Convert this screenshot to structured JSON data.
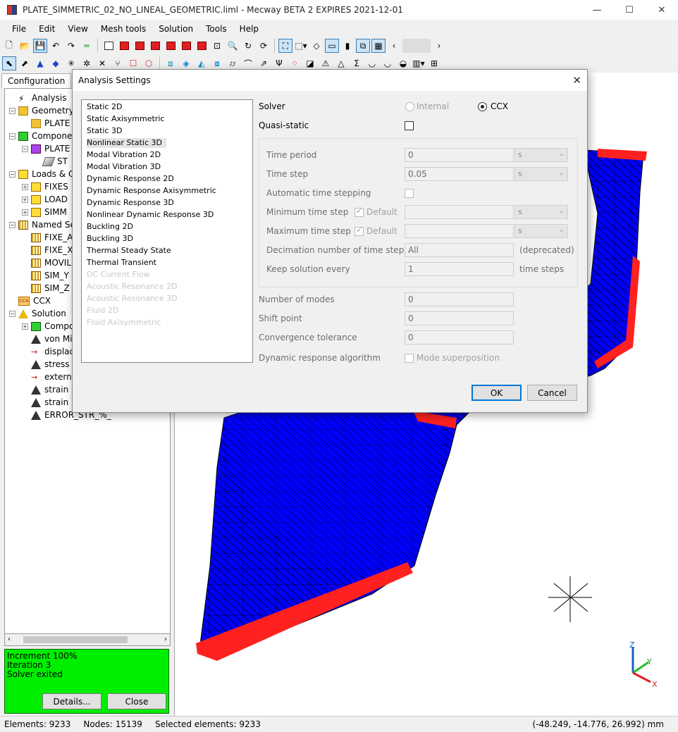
{
  "window": {
    "title": "PLATE_SIMMETRIC_02_NO_LINEAL_GEOMETRIC.liml - Mecway BETA 2 EXPIRES 2021-12-01",
    "minimize": "—",
    "maximize": "☐",
    "close": "✕"
  },
  "menu": [
    "File",
    "Edit",
    "View",
    "Mesh tools",
    "Solution",
    "Tools",
    "Help"
  ],
  "left_tab": "Configuration",
  "tree": [
    {
      "label": "Analysis",
      "indent": 0,
      "icon": "bolt",
      "toggle": ""
    },
    {
      "label": "Geometry",
      "indent": 0,
      "icon": "folder",
      "toggle": "−"
    },
    {
      "label": "PLATE",
      "indent": 1,
      "icon": "folder",
      "toggle": ""
    },
    {
      "label": "Components",
      "indent": 0,
      "icon": "green",
      "toggle": "−"
    },
    {
      "label": "PLATE",
      "indent": 1,
      "icon": "purple",
      "toggle": "−"
    },
    {
      "label": "ST",
      "indent": 2,
      "icon": "sheet",
      "toggle": ""
    },
    {
      "label": "Loads & Constraints",
      "indent": 0,
      "icon": "yellow",
      "toggle": "−"
    },
    {
      "label": "FIXES",
      "indent": 1,
      "icon": "yellow",
      "toggle": "+"
    },
    {
      "label": "LOAD",
      "indent": 1,
      "icon": "yellow",
      "toggle": "+"
    },
    {
      "label": "SIMM",
      "indent": 1,
      "icon": "yellow",
      "toggle": "+"
    },
    {
      "label": "Named Selections",
      "indent": 0,
      "icon": "cage",
      "toggle": "−"
    },
    {
      "label": "FIXE_A",
      "indent": 1,
      "icon": "cage",
      "toggle": ""
    },
    {
      "label": "FIXE_X",
      "indent": 1,
      "icon": "cage",
      "toggle": ""
    },
    {
      "label": "MOVIL",
      "indent": 1,
      "icon": "cage",
      "toggle": ""
    },
    {
      "label": "SIM_Y",
      "indent": 1,
      "icon": "cage",
      "toggle": ""
    },
    {
      "label": "SIM_Z",
      "indent": 1,
      "icon": "cage",
      "toggle": ""
    },
    {
      "label": "CCX",
      "indent": 0,
      "icon": "ccx",
      "toggle": ""
    },
    {
      "label": "Solution",
      "indent": 0,
      "icon": "tri-y",
      "toggle": "−"
    },
    {
      "label": "Components",
      "indent": 1,
      "icon": "green",
      "toggle": "+"
    },
    {
      "label": "von Mises",
      "indent": 1,
      "icon": "tri",
      "toggle": ""
    },
    {
      "label": "displacement",
      "indent": 1,
      "icon": "arrow",
      "toggle": ""
    },
    {
      "label": "stress",
      "indent": 1,
      "icon": "tri",
      "toggle": ""
    },
    {
      "label": "external",
      "indent": 1,
      "icon": "arrow",
      "toggle": ""
    },
    {
      "label": "strain",
      "indent": 1,
      "icon": "tri",
      "toggle": ""
    },
    {
      "label": "strain",
      "indent": 1,
      "icon": "tri",
      "toggle": ""
    },
    {
      "label": "ERROR_STR_%_",
      "indent": 1,
      "icon": "tri",
      "toggle": ""
    }
  ],
  "status_box": {
    "lines": [
      "Increment 100%",
      "Iteration 3",
      "Solver exited"
    ],
    "details": "Details...",
    "close": "Close",
    "color": "#00ee00"
  },
  "statusbar": {
    "elements": "Elements: 9233",
    "nodes": "Nodes: 15139",
    "selected": "Selected elements: 9233",
    "coords": "(-48.249, -14.776, 26.992) mm"
  },
  "dialog": {
    "title": "Analysis Settings",
    "close": "✕",
    "analysis_types": [
      {
        "label": "Static 2D",
        "state": "normal"
      },
      {
        "label": "Static Axisymmetric",
        "state": "normal"
      },
      {
        "label": "Static 3D",
        "state": "normal"
      },
      {
        "label": "Nonlinear Static 3D",
        "state": "selected"
      },
      {
        "label": "Modal Vibration 2D",
        "state": "normal"
      },
      {
        "label": "Modal Vibration 3D",
        "state": "normal"
      },
      {
        "label": "Dynamic Response 2D",
        "state": "normal"
      },
      {
        "label": "Dynamic Response Axisymmetric",
        "state": "normal"
      },
      {
        "label": "Dynamic Response 3D",
        "state": "normal"
      },
      {
        "label": "Nonlinear Dynamic Response 3D",
        "state": "normal"
      },
      {
        "label": "Buckling 2D",
        "state": "normal"
      },
      {
        "label": "Buckling 3D",
        "state": "normal"
      },
      {
        "label": "Thermal Steady State",
        "state": "normal"
      },
      {
        "label": "Thermal Transient",
        "state": "normal"
      },
      {
        "label": "DC Current Flow",
        "state": "disabled"
      },
      {
        "label": "Acoustic Resonance 2D",
        "state": "disabled"
      },
      {
        "label": "Acoustic Resonance 3D",
        "state": "disabled"
      },
      {
        "label": "Fluid 2D",
        "state": "disabled"
      },
      {
        "label": "Fluid Axisymmetric",
        "state": "disabled"
      }
    ],
    "solver_label": "Solver",
    "solver_internal": "Internal",
    "solver_ccx": "CCX",
    "quasi_static": "Quasi-static",
    "time_period": {
      "label": "Time period",
      "value": "0",
      "unit": "s"
    },
    "time_step": {
      "label": "Time step",
      "value": "0.05",
      "unit": "s"
    },
    "auto_step": "Automatic time stepping",
    "min_step": {
      "label": "Minimum time step",
      "default": "Default",
      "value": "",
      "unit": "s"
    },
    "max_step": {
      "label": "Maximum time step",
      "default": "Default",
      "value": "",
      "unit": "s"
    },
    "decimation": {
      "label": "Decimation number of time steps",
      "value": "All",
      "note": "(deprecated)"
    },
    "keep_solution": {
      "label": "Keep solution every",
      "value": "1",
      "unit": "time steps"
    },
    "num_modes": {
      "label": "Number of modes",
      "value": "0"
    },
    "shift_point": {
      "label": "Shift point",
      "value": "0"
    },
    "convergence": {
      "label": "Convergence tolerance",
      "value": "0"
    },
    "dyn_algo": {
      "label": "Dynamic response algorithm",
      "option": "Mode superposition"
    },
    "ok": "OK",
    "cancel": "Cancel"
  },
  "axes": {
    "z": "Z",
    "y": "Y",
    "x": "X"
  },
  "colors": {
    "mesh": "#0000ff",
    "constraint": "#ff2020",
    "status_green": "#00ee00"
  }
}
